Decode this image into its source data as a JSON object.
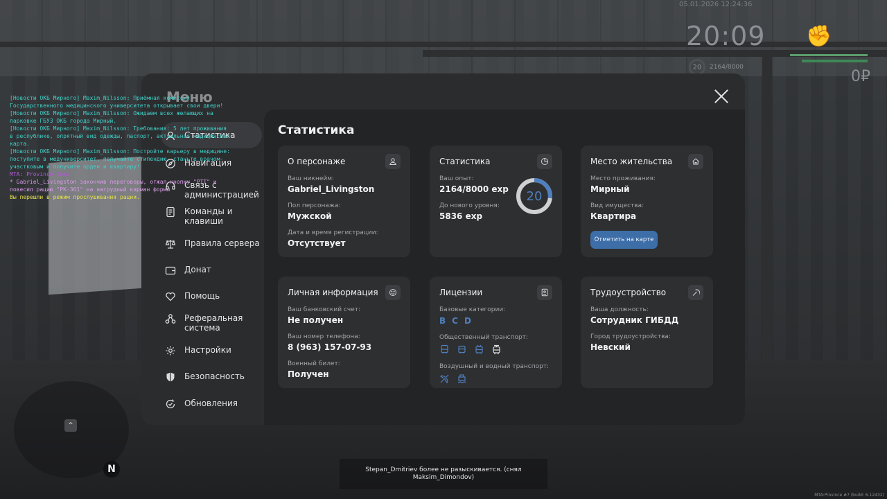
{
  "hud": {
    "date": "05.01.2026 12:24:36",
    "time": "20:09",
    "level": "20",
    "xp": "2164/8000",
    "money": "0₽",
    "health_color": "#5a9c6c"
  },
  "chat": [
    {
      "type": "news",
      "text": "[Новости ОКБ Мирного] Maxim_Nilsson: Приёмная комиссия Государственного медицинского университета открывает свои двери!"
    },
    {
      "type": "news",
      "text": "[Новости ОКБ Мирного] Maxim_Nilsson: Ожидаем всех желающих на парковке ГБУЗ ОКБ города Мирный."
    },
    {
      "type": "news",
      "text": "[Новости ОКБ Мирного] Maxim_Nilsson: Требования: 5 лет проживания в республике, опрятный вид одежды, паспорт, актуальная медицинская карта."
    },
    {
      "type": "news",
      "text": "[Новости ОКБ Мирного] Maxim_Nilsson: Постройте карьеру в медицине: поступите в медуниверситет, получайте стипендию, станьте врачом-участковым и получите орден и квартиру!"
    },
    {
      "type": "demo",
      "text": "MTA: Province Demo"
    },
    {
      "type": "me",
      "text": "* Gabriel_Livingston закончив переговоры, отжал кнопку \"PTT\" и повесил рацию \"PK-361\" на нагрудный карман формы"
    },
    {
      "type": "radio",
      "text": "Вы перешли в режим прослушивания рации."
    }
  ],
  "menu": {
    "title": "Меню",
    "nav": [
      {
        "label": "Статистика",
        "icon": "user-icon"
      },
      {
        "label": "Навигация",
        "icon": "compass-icon"
      },
      {
        "label": "Связь с администрацией",
        "icon": "headset-icon"
      },
      {
        "label": "Команды и клавиши",
        "icon": "document-icon"
      },
      {
        "label": "Правила сервера",
        "icon": "scales-icon"
      },
      {
        "label": "Донат",
        "icon": "wallet-icon"
      },
      {
        "label": "Помощь",
        "icon": "heart-hand-icon"
      },
      {
        "label": "Реферальная система",
        "icon": "network-icon"
      },
      {
        "label": "Настройки",
        "icon": "gear-icon"
      },
      {
        "label": "Безопасность",
        "icon": "shield-icon"
      },
      {
        "label": "Обновления",
        "icon": "refresh-check-icon"
      }
    ]
  },
  "stats": {
    "title": "Статистика",
    "character": {
      "title": "О персонаже",
      "nickname_label": "Ваш никнейм:",
      "nickname": "Gabriel_Livingston",
      "gender_label": "Пол персонажа:",
      "gender": "Мужской",
      "reg_label": "Дата и время регистрации:",
      "reg": "Отсутствует"
    },
    "experience": {
      "title": "Статистика",
      "exp_label": "Ваш опыт:",
      "exp": "2164/8000 exp",
      "next_label": "До нового уровня:",
      "next": "5836 exp",
      "level": "20",
      "progress": 0.2705,
      "accent": "#4f7fbd"
    },
    "residence": {
      "title": "Место жительства",
      "place_label": "Место проживания:",
      "place": "Мирный",
      "property_label": "Вид имущества:",
      "property": "Квартира",
      "map_button": "Отметить на карте"
    },
    "personal": {
      "title": "Личная информация",
      "bank_label": "Ваш банковский счет:",
      "bank": "Не получен",
      "phone_label": "Ваш номер телефона:",
      "phone": "8 (963) 157-07-93",
      "military_label": "Военный билет:",
      "military": "Получен"
    },
    "licenses": {
      "title": "Лицензии",
      "base_label": "Базовые категории:",
      "categories": [
        "B",
        "C",
        "D"
      ],
      "public_label": "Общественный транспорт:",
      "public_icons": [
        "bus-icon",
        "bus-icon",
        "trolleybus-icon",
        "tram-icon"
      ],
      "air_label": "Воздушный и водный транспорт:",
      "air_icons": [
        "airplane-icon",
        "ship-icon"
      ]
    },
    "employment": {
      "title": "Трудоустройство",
      "position_label": "Ваша должность:",
      "position": "Сотрудник ГИБДД",
      "city_label": "Город трудоустройства:",
      "city": "Невский"
    }
  },
  "minimap": {
    "north": "N"
  },
  "notice": "Stepan_Dmitriev более не разыскивается. (снял Maksim_Dimondov)",
  "build": "MTA:Province #7 (build: 6.12432)"
}
